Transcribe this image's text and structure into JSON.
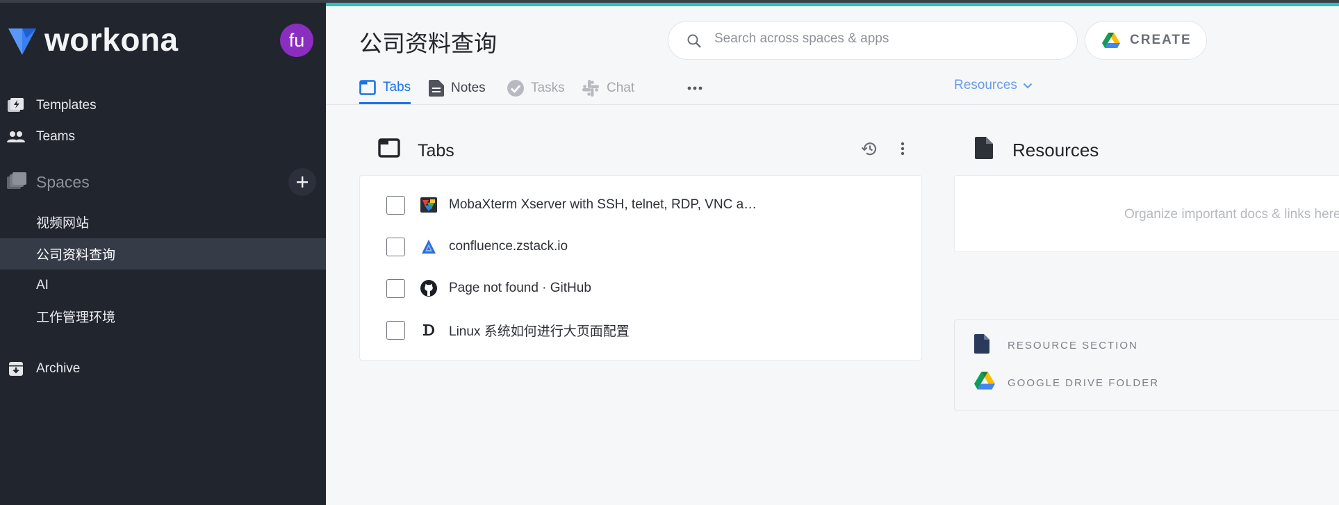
{
  "app": {
    "brand_name": "workona",
    "avatar_initials": "fu",
    "accent_color": "#27c4b8",
    "sidebar_bg": "#21252e"
  },
  "sidebar": {
    "nav": [
      {
        "label": "Templates",
        "icon": "lightning-template-icon"
      },
      {
        "label": "Teams",
        "icon": "people-icon"
      }
    ],
    "spaces_label": "Spaces",
    "spaces": [
      {
        "label": "视频网站",
        "active": false
      },
      {
        "label": "公司资料查询",
        "active": true
      },
      {
        "label": "AI",
        "active": false
      },
      {
        "label": "工作管理环境",
        "active": false
      }
    ],
    "archive_label": "Archive"
  },
  "header": {
    "title": "公司资料查询",
    "search_placeholder": "Search across spaces & apps",
    "create_label": "CREATE"
  },
  "tabs": [
    {
      "label": "Tabs",
      "state": "active"
    },
    {
      "label": "Notes",
      "state": "normal"
    },
    {
      "label": "Tasks",
      "state": "disabled"
    },
    {
      "label": "Chat",
      "state": "disabled"
    }
  ],
  "resources_dropdown": "Resources",
  "tabs_panel": {
    "title": "Tabs",
    "items": [
      {
        "title": "MobaXterm Xserver with SSH, telnet, RDP, VNC a…",
        "favicon": "mobaxterm-icon"
      },
      {
        "title": "confluence.zstack.io",
        "favicon": "confluence-icon"
      },
      {
        "title": "Page not found · GitHub",
        "favicon": "github-icon"
      },
      {
        "title": "Linux 系统如何进行大页面配置",
        "favicon": "d-letter-icon"
      }
    ]
  },
  "resources_panel": {
    "title": "Resources",
    "empty_text": "Organize important docs & links here",
    "add_options": [
      {
        "label": "RESOURCE SECTION",
        "icon": "document-icon"
      },
      {
        "label": "GOOGLE DRIVE FOLDER",
        "icon": "google-drive-icon"
      }
    ]
  }
}
